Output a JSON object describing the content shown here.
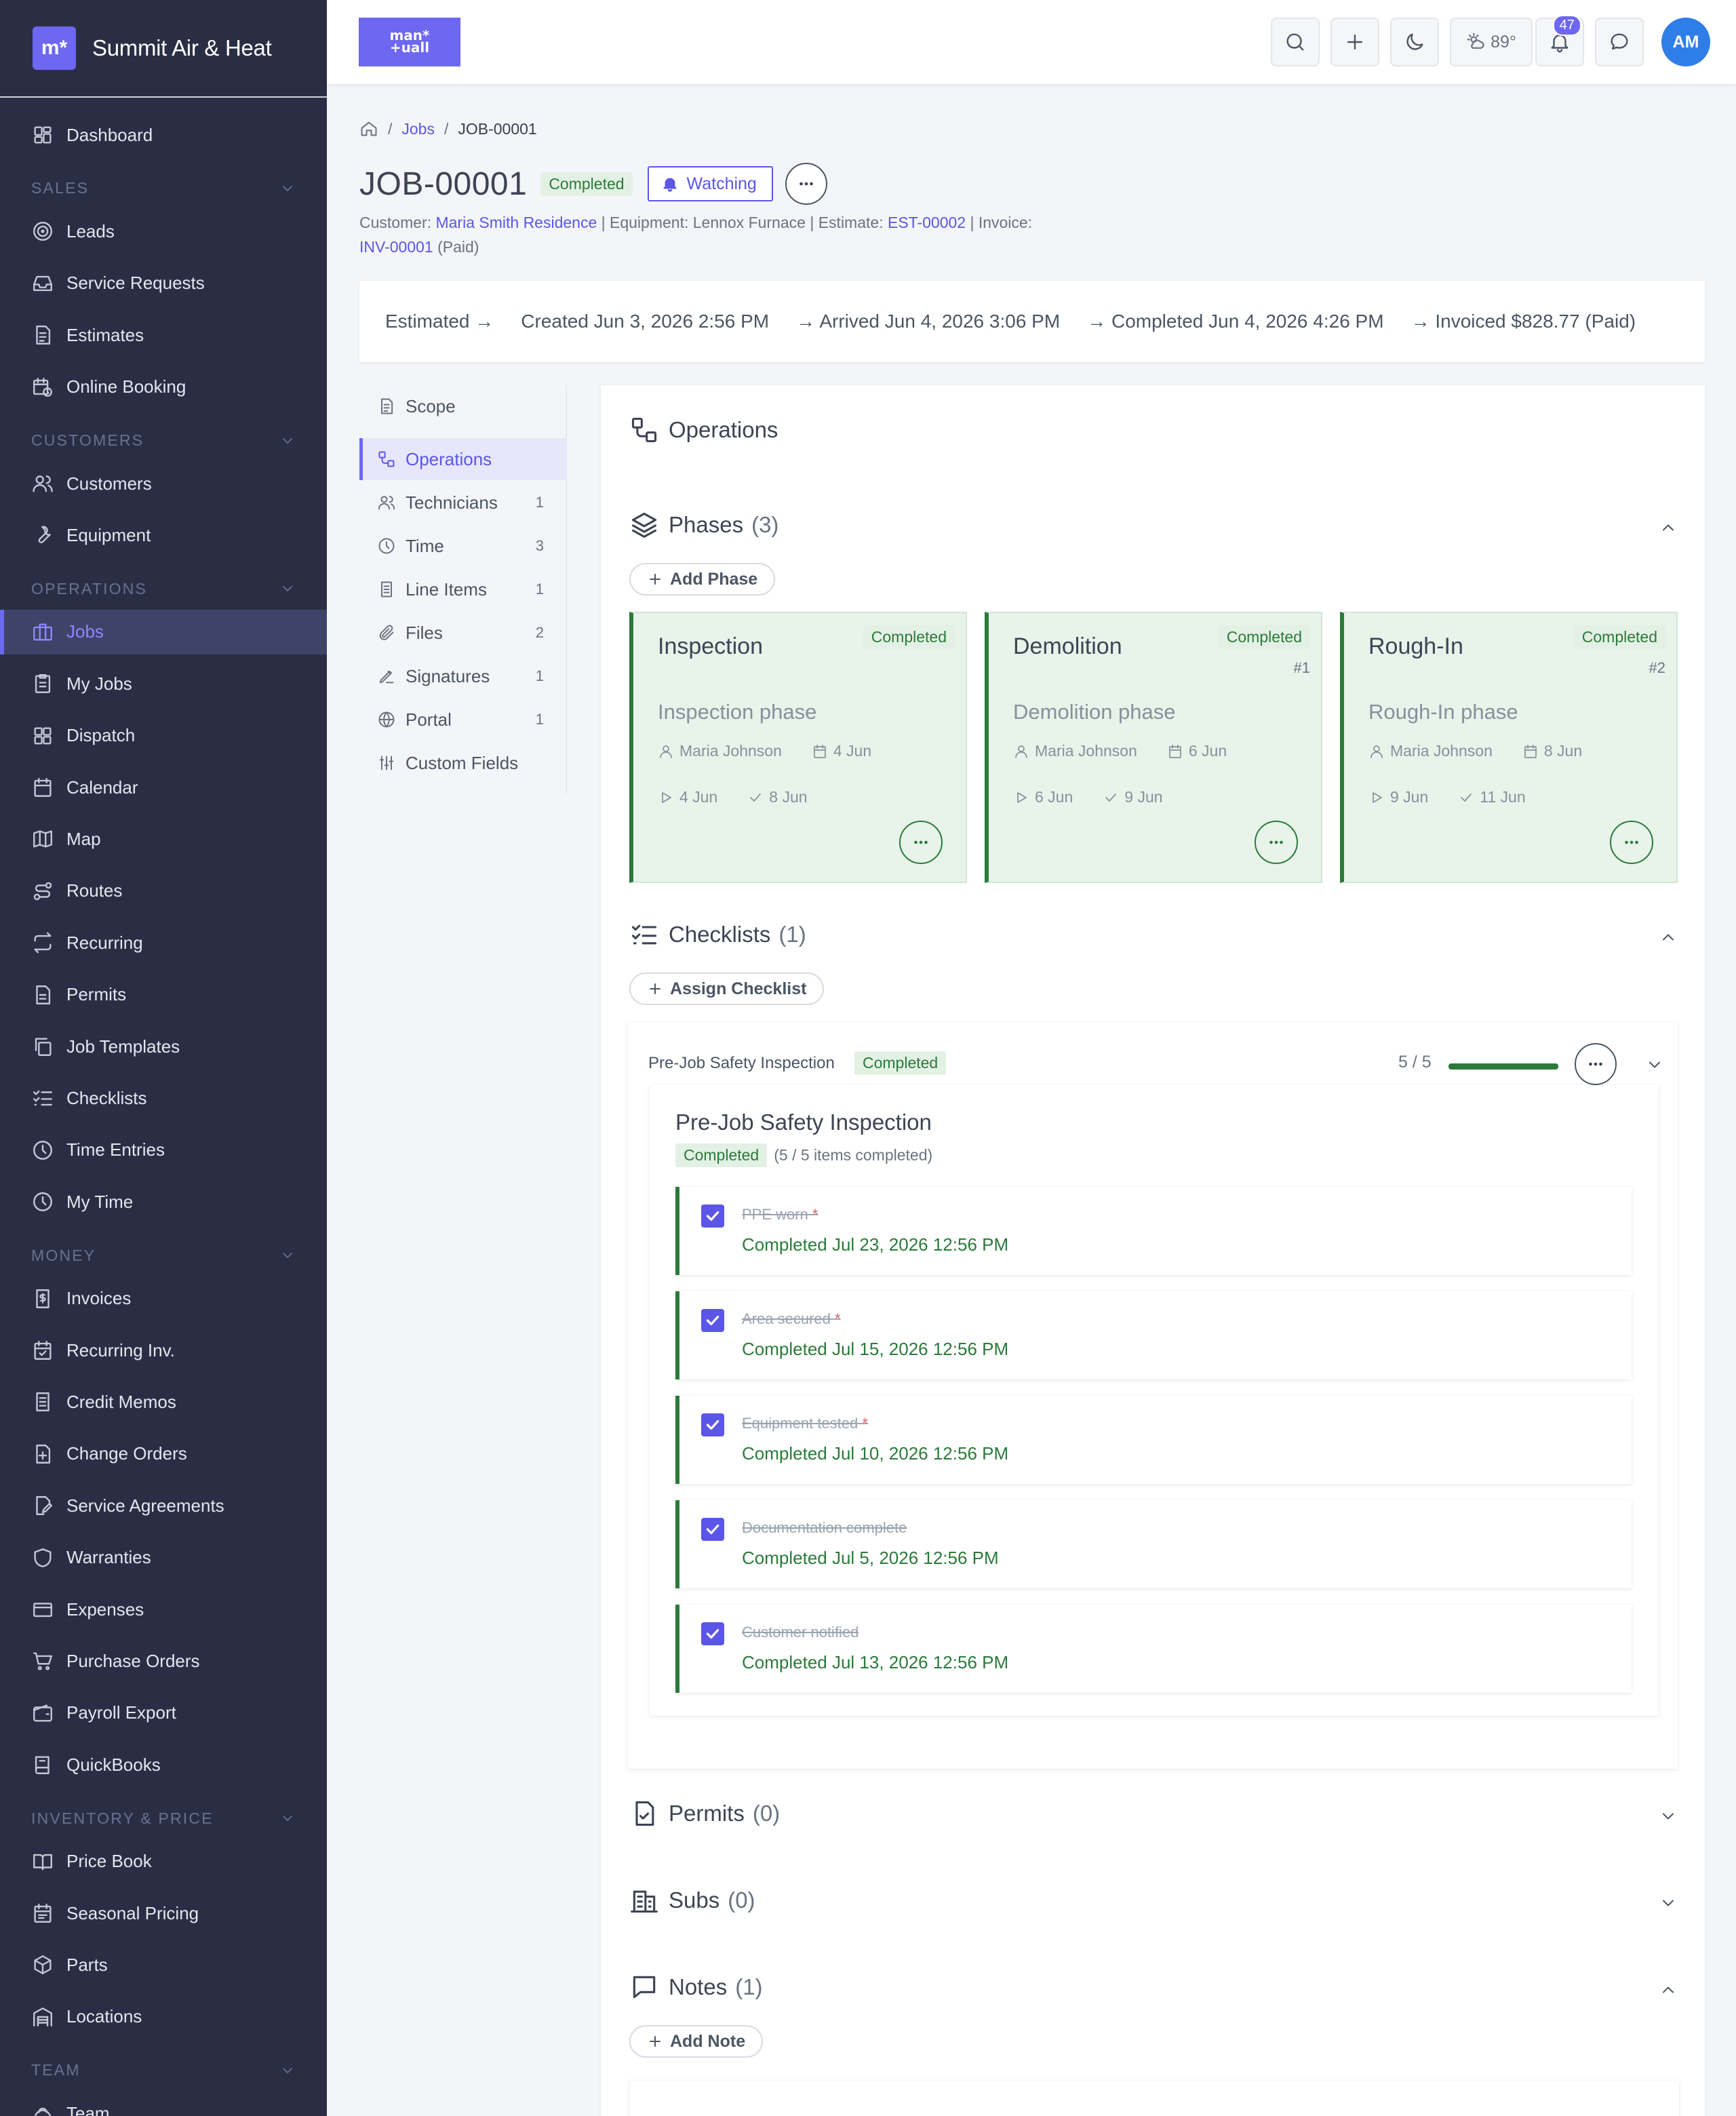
{
  "brand": {
    "logo": "m*",
    "name": "Summit Air & Heat"
  },
  "sidebar": {
    "items": [
      {
        "label": "Dashboard",
        "icon": "dashboard-icon"
      },
      {
        "section": "SALES"
      },
      {
        "label": "Leads",
        "icon": "target-icon"
      },
      {
        "label": "Service Requests",
        "icon": "inbox-icon"
      },
      {
        "label": "Estimates",
        "icon": "document-icon"
      },
      {
        "label": "Online Booking",
        "icon": "calendar-clock-icon"
      },
      {
        "section": "CUSTOMERS"
      },
      {
        "label": "Customers",
        "icon": "users-icon"
      },
      {
        "label": "Equipment",
        "icon": "wrench-icon"
      },
      {
        "section": "OPERATIONS"
      },
      {
        "label": "Jobs",
        "icon": "briefcase-icon",
        "active": true
      },
      {
        "label": "My Jobs",
        "icon": "clipboard-icon"
      },
      {
        "label": "Dispatch",
        "icon": "grid-icon"
      },
      {
        "label": "Calendar",
        "icon": "calendar-icon"
      },
      {
        "label": "Map",
        "icon": "map-icon"
      },
      {
        "label": "Routes",
        "icon": "route-icon"
      },
      {
        "label": "Recurring",
        "icon": "repeat-icon"
      },
      {
        "label": "Permits",
        "icon": "file-text-icon"
      },
      {
        "label": "Job Templates",
        "icon": "copy-icon"
      },
      {
        "label": "Checklists",
        "icon": "list-checks-icon"
      },
      {
        "label": "Time Entries",
        "icon": "clock-icon"
      },
      {
        "label": "My Time",
        "icon": "clock-icon"
      },
      {
        "section": "MONEY"
      },
      {
        "label": "Invoices",
        "icon": "dollar-doc-icon"
      },
      {
        "label": "Recurring Inv.",
        "icon": "calendar-check-icon"
      },
      {
        "label": "Credit Memos",
        "icon": "receipt-icon"
      },
      {
        "label": "Change Orders",
        "icon": "file-plus-icon"
      },
      {
        "label": "Service Agreements",
        "icon": "file-edit-icon"
      },
      {
        "label": "Warranties",
        "icon": "shield-icon"
      },
      {
        "label": "Expenses",
        "icon": "credit-card-icon"
      },
      {
        "label": "Purchase Orders",
        "icon": "cart-icon"
      },
      {
        "label": "Payroll Export",
        "icon": "wallet-icon"
      },
      {
        "label": "QuickBooks",
        "icon": "book-icon"
      },
      {
        "section": "INVENTORY & PRICE"
      },
      {
        "label": "Price Book",
        "icon": "book-open-icon"
      },
      {
        "label": "Seasonal Pricing",
        "icon": "calendar-range-icon"
      },
      {
        "label": "Parts",
        "icon": "package-icon"
      },
      {
        "label": "Locations",
        "icon": "warehouse-icon"
      },
      {
        "section": "TEAM"
      },
      {
        "label": "Team",
        "icon": "team-icon"
      }
    ]
  },
  "topbar": {
    "logo_line1": "man*",
    "logo_line2": "+uall",
    "weather": "89°",
    "notifications": "47",
    "avatar": "AM"
  },
  "breadcrumb": {
    "jobs": "Jobs",
    "current": "JOB-00001",
    "sep": "/"
  },
  "job": {
    "title": "JOB-00001",
    "status": "Completed",
    "watch_label": "Watching",
    "meta": {
      "customer_label": "Customer:",
      "customer": "Maria Smith Residence",
      "equipment": "| Equipment: Lennox Furnace | Estimate:",
      "estimate": "EST-00002",
      "invoice_label": "| Invoice:",
      "invoice": "INV-00001",
      "invoice_status": "(Paid)"
    }
  },
  "timeline": [
    "Estimated →",
    "Created Jun 3, 2026 2:56 PM",
    "→ Arrived Jun 4, 2026 3:06 PM",
    "→ Completed Jun 4, 2026 4:26 PM",
    "→ Invoiced $828.77 (Paid)"
  ],
  "tabs": [
    {
      "label": "Scope",
      "count": ""
    },
    {
      "label": "Operations",
      "count": "",
      "active": true
    },
    {
      "label": "Technicians",
      "count": "1"
    },
    {
      "label": "Time",
      "count": "3"
    },
    {
      "label": "Line Items",
      "count": "1"
    },
    {
      "label": "Files",
      "count": "2"
    },
    {
      "label": "Signatures",
      "count": "1"
    },
    {
      "label": "Portal",
      "count": "1"
    },
    {
      "label": "Custom Fields",
      "count": ""
    }
  ],
  "operations": {
    "title": "Operations",
    "phases": {
      "label": "Phases",
      "count": "(3)",
      "add_label": "Add Phase",
      "items": [
        {
          "name": "Inspection",
          "status": "Completed",
          "number": "",
          "description": "Inspection phase",
          "assignee": "Maria Johnson",
          "scheduled": "4 Jun",
          "start": "4 Jun",
          "end": "8 Jun"
        },
        {
          "name": "Demolition",
          "status": "Completed",
          "number": "#1",
          "description": "Demolition phase",
          "assignee": "Maria Johnson",
          "scheduled": "6 Jun",
          "start": "6 Jun",
          "end": "9 Jun"
        },
        {
          "name": "Rough-In",
          "status": "Completed",
          "number": "#2",
          "description": "Rough-In phase",
          "assignee": "Maria Johnson",
          "scheduled": "8 Jun",
          "start": "9 Jun",
          "end": "11 Jun"
        }
      ]
    },
    "checklists": {
      "label": "Checklists",
      "count": "(1)",
      "add_label": "Assign Checklist",
      "item": {
        "name": "Pre-Job Safety Inspection",
        "status": "Completed",
        "progress_text": "5 / 5",
        "progress": 1.0,
        "title": "Pre-Job Safety Inspection",
        "summary": "(5 / 5 items completed)",
        "entries": [
          {
            "label": "PPE worn",
            "required": true,
            "completed": "Completed Jul 23, 2026 12:56 PM"
          },
          {
            "label": "Area secured",
            "required": true,
            "completed": "Completed Jul 15, 2026 12:56 PM"
          },
          {
            "label": "Equipment tested",
            "required": true,
            "completed": "Completed Jul 10, 2026 12:56 PM"
          },
          {
            "label": "Documentation complete",
            "required": false,
            "completed": "Completed Jul 5, 2026 12:56 PM"
          },
          {
            "label": "Customer notified",
            "required": false,
            "completed": "Completed Jul 13, 2026 12:56 PM"
          }
        ]
      }
    },
    "permits": {
      "label": "Permits",
      "count": "(0)"
    },
    "subs": {
      "label": "Subs",
      "count": "(0)"
    },
    "notes": {
      "label": "Notes",
      "count": "(1)",
      "add_label": "Add Note"
    }
  },
  "colors": {
    "accent": "#6d67f2",
    "sidebar_bg": "#2a2e45",
    "success": "#2b7a3a",
    "phase_bg": "#e8f3ea"
  }
}
